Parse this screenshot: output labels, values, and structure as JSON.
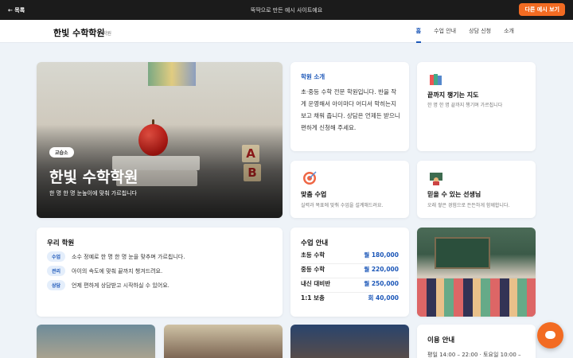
{
  "topbar": {
    "back_label": "← 목록",
    "notice": "뚝딱으로 만든 예시 사이트예요",
    "other_button": "다른 예시 보기"
  },
  "header": {
    "brand": "한빛 수학학원",
    "brand_sub": "학원",
    "nav": [
      "홈",
      "수업 안내",
      "상담 신청",
      "소개"
    ],
    "active_nav": "홈"
  },
  "hero": {
    "badge": "교습소",
    "title": "한빛 수학학원",
    "subtitle": "한 명 한 명 눈높이에 맞춰 가르칩니다",
    "blocks": [
      "A",
      "B"
    ]
  },
  "intro": {
    "heading": "학원 소개",
    "body": "초·중등 수학 전문 학원입니다. 반을 작게 운영해서 아이마다 어디서 막히는지 보고 채워 줍니다. 상담은 언제든 받으니 편하게 신청해 주세요."
  },
  "features": [
    {
      "icon": "books-icon",
      "title": "끝까지 챙기는 지도",
      "desc": "한 명 한 명 끝까지 챙기며 가르칩니다"
    },
    {
      "icon": "target-icon",
      "title": "맞춤 수업",
      "desc": "실력과 목표에 맞춰 수업을 설계해드려요."
    },
    {
      "icon": "teacher-icon",
      "title": "믿을 수 있는 선생님",
      "desc": "오래 쌓은 경험으로 든든하게 함께합니다."
    }
  ],
  "about": {
    "heading": "우리 학원",
    "rows": [
      {
        "tag": "수업",
        "text": "소수 정예로 한 명 한 명 눈을 맞추며 가르칩니다."
      },
      {
        "tag": "관리",
        "text": "아이의 속도에 맞춰 끝까지 챙겨드려요."
      },
      {
        "tag": "상담",
        "text": "언제 편하게 상담받고 시작하실 수 있어요."
      }
    ]
  },
  "pricing": {
    "heading": "수업 안내",
    "rows": [
      {
        "name": "초등 수학",
        "price": "월 180,000"
      },
      {
        "name": "중등 수학",
        "price": "월 220,000"
      },
      {
        "name": "내신 대비반",
        "price": "월 250,000"
      },
      {
        "name": "1:1 보충",
        "price": "회 40,000"
      }
    ]
  },
  "info": {
    "heading": "이용 안내",
    "hours": "평일 14:00 – 22:00 · 토요일 10:00 –"
  },
  "colors": {
    "accent": "#1c57b8",
    "brand_orange": "#f26b22",
    "topbar": "#1b1b1b",
    "background": "#eef3f8"
  },
  "fab_icon": "chat-icon"
}
